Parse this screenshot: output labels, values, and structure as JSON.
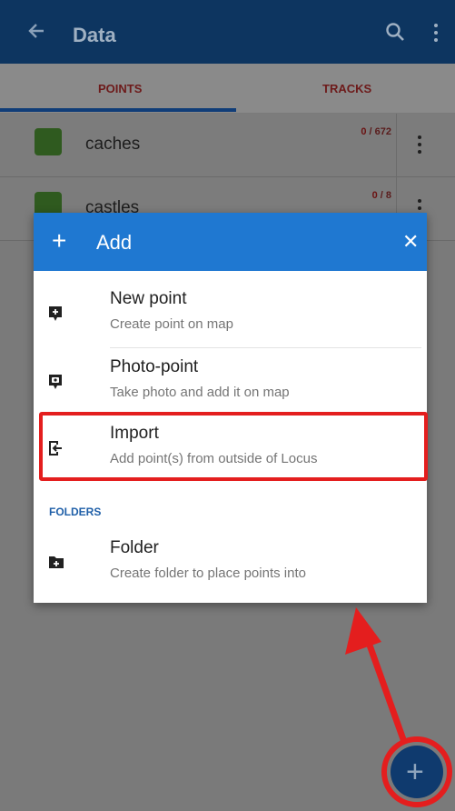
{
  "appbar": {
    "title": "Data"
  },
  "tabs": [
    {
      "label": "POINTS"
    },
    {
      "label": "TRACKS"
    }
  ],
  "rows": [
    {
      "label": "caches",
      "count_selected": "0",
      "count_total": " / 672"
    },
    {
      "label": "castles",
      "count_selected": "0",
      "count_total": " / 8"
    }
  ],
  "dialog": {
    "title": "Add",
    "items": [
      {
        "title": "New point",
        "subtitle": "Create point on map"
      },
      {
        "title": "Photo-point",
        "subtitle": "Take photo and add it on map"
      },
      {
        "title": "Import",
        "subtitle": "Add point(s) from outside of Locus"
      }
    ],
    "folders_header": "FOLDERS",
    "folder_item": {
      "title": "Folder",
      "subtitle": "Create folder to place points into"
    }
  },
  "fab": {
    "symbol": "+"
  },
  "colors": {
    "dialog_header": "#1f78d1",
    "highlight": "#e41e1e",
    "appbar_dimmed": "#0d3560"
  }
}
